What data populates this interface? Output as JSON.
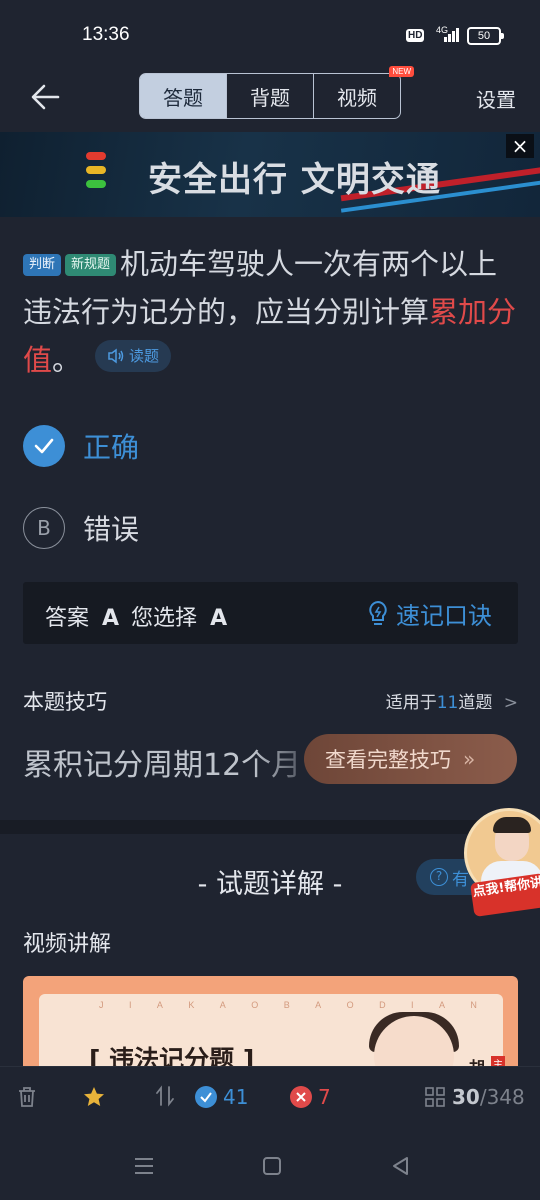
{
  "status_bar": {
    "time": "13:36",
    "hd": "HD",
    "network": "4G",
    "battery": "50"
  },
  "header": {
    "tabs": [
      {
        "label": "答题",
        "active": true
      },
      {
        "label": "背题",
        "active": false
      },
      {
        "label": "视频",
        "active": false,
        "badge": "NEW"
      }
    ],
    "settings_label": "设置"
  },
  "banner": {
    "text": "安全出行 文明交通",
    "close": "×"
  },
  "question": {
    "tags": [
      "判断",
      "新规题"
    ],
    "text_part1": "机动车驾驶人一次有两个以上违法行为记分的，应当分别计算",
    "highlight": "累加分值",
    "text_part2": "。",
    "read_label": "读题"
  },
  "options": [
    {
      "mark": "✓",
      "text": "正确",
      "selected": true
    },
    {
      "mark": "B",
      "text": "错误",
      "selected": false
    }
  ],
  "answer_box": {
    "answer_label": "答案",
    "answer_value": "A",
    "choice_label": "您选择",
    "choice_value": "A",
    "memo_label": "速记口诀"
  },
  "tips": {
    "title": "本题技巧",
    "applies_prefix": "适用于",
    "applies_count": "11",
    "applies_suffix": "道题",
    "text": "累积记分周期12个月",
    "button_label": "查看完整技巧",
    "button_chevron": "»"
  },
  "detail": {
    "title": "- 试题详解 -",
    "question_pill": "有",
    "avatar_tag": "点我!帮你讲",
    "video_title": "视频讲解",
    "video_letters": [
      "J",
      "I",
      "A",
      "K",
      "A",
      "O",
      "B",
      "A",
      "O",
      "D",
      "I",
      "A",
      "N"
    ],
    "video_label": "[ 违法记分题 ]",
    "video_side": "胡",
    "video_red": "主"
  },
  "bottom_bar": {
    "correct_count": "41",
    "wrong_count": "7",
    "progress_current": "30",
    "progress_total": "/348"
  },
  "colors": {
    "background": "#1f2430",
    "accent": "#3d8fd6",
    "highlight": "#e04a4a"
  }
}
